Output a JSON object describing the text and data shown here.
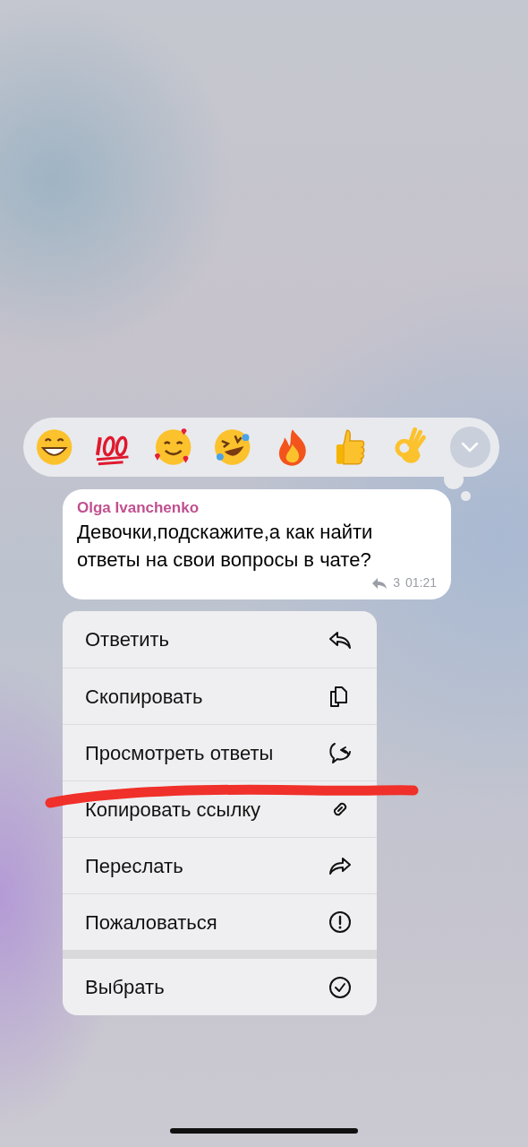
{
  "message": {
    "author": "Olga Ivanchenko",
    "text": "Девочки,подскажите,а как найти ответы на свои вопросы в чате?",
    "replies": "3",
    "time": "01:21"
  },
  "menu_groups": [
    [
      "Ответить",
      "Скопировать",
      "Просмотреть ответы",
      "Копировать ссылку",
      "Переслать",
      "Пожаловаться"
    ],
    [
      "Выбрать"
    ]
  ]
}
